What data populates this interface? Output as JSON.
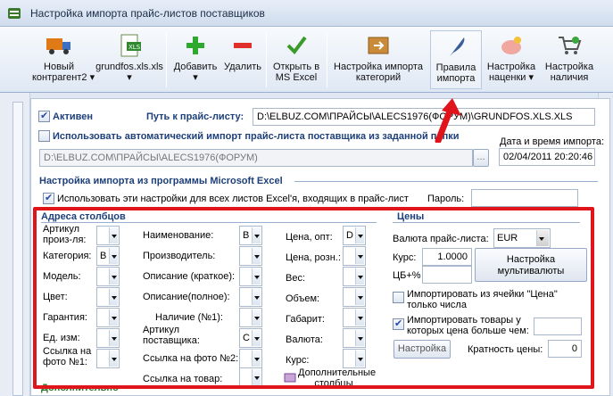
{
  "window": {
    "title": "Настройка импорта прайс-листов поставщиков"
  },
  "toolbar": {
    "items": [
      {
        "label1": "Новый",
        "label2": "контрагент2",
        "dropdown": true,
        "icon": "truck-icon"
      },
      {
        "label1": "grundfos.xls.xls",
        "label2": "",
        "dropdown": true,
        "icon": "xls-file-icon"
      },
      {
        "label1": "Добавить",
        "label2": "",
        "dropdown": true,
        "icon": "plus-icon"
      },
      {
        "label1": "Удалить",
        "label2": "",
        "dropdown": false,
        "icon": "minus-icon"
      },
      {
        "label1": "Открыть в",
        "label2": "MS Excel",
        "dropdown": false,
        "icon": "checkmark-icon"
      },
      {
        "label1": "Настройка импорта",
        "label2": "категорий",
        "dropdown": false,
        "icon": "import-box-icon"
      },
      {
        "label1": "Правила",
        "label2": "импорта",
        "dropdown": false,
        "icon": "feather-pen-icon"
      },
      {
        "label1": "Настройка",
        "label2": "наценки",
        "dropdown": true,
        "icon": "piggy-bank-icon"
      },
      {
        "label1": "Настройка",
        "label2": "наличия",
        "dropdown": false,
        "icon": "shopping-cart-icon"
      }
    ]
  },
  "form": {
    "active_label": "Активен",
    "active_checked": true,
    "path_label": "Путь к прайс-листу:",
    "path_value": "D:\\ELBUZ.COM\\ПРАЙСЫ\\ALECS1976(ФОРУМ)\\GRUNDFOS.XLS.XLS",
    "auto_import_label": "Использовать автоматический импорт прайс-листа поставщика из заданной папки",
    "auto_path_value": "D:\\ELBUZ.COM\\ПРАЙСЫ\\ALECS1976(ФОРУМ)",
    "browse_label": "...",
    "datetime_label": "Дата и время импорта:",
    "datetime_value": "02/04/2011 20:20:46",
    "excel_header": "Настройка импорта из программы Microsoft Excel",
    "use_all_sheets_label": "Использовать эти настройки для всех листов Excel'я, входящих в прайс-лист",
    "password_label": "Пароль:",
    "columns_header": "Адреса столбцов",
    "prices_header": "Цены",
    "col1": [
      {
        "l1": "Артикул",
        "l2": "произ-ля:",
        "v": ""
      },
      {
        "l1": "Категория:",
        "l2": "",
        "v": "B"
      },
      {
        "l1": "Модель:",
        "l2": "",
        "v": ""
      },
      {
        "l1": "Цвет:",
        "l2": "",
        "v": ""
      },
      {
        "l1": "Гарантия:",
        "l2": "",
        "v": ""
      },
      {
        "l1": "Ед. изм:",
        "l2": "",
        "v": ""
      },
      {
        "l1": "Ссылка на",
        "l2": "фото №1:",
        "v": ""
      }
    ],
    "col2": [
      {
        "l1": "Наименование:",
        "l2": "",
        "v": "B"
      },
      {
        "l1": "Производитель:",
        "l2": "",
        "v": ""
      },
      {
        "l1": "Описание (краткое):",
        "l2": "",
        "v": ""
      },
      {
        "l1": "Описание(полное):",
        "l2": "",
        "v": ""
      },
      {
        "l1": "Наличие (№1):",
        "l2": "",
        "v": ""
      },
      {
        "l1": "Артикул",
        "l2": "поставщика:",
        "v": "C"
      },
      {
        "l1": "Ссылка на фото №2:",
        "l2": "",
        "v": ""
      },
      {
        "l1": "Ссылка на товар:",
        "l2": "",
        "v": ""
      }
    ],
    "col3": [
      {
        "l1": "Цена, опт:",
        "l2": "",
        "v": "D"
      },
      {
        "l1": "Цена, розн.:",
        "l2": "",
        "v": ""
      },
      {
        "l1": "Вес:",
        "l2": "",
        "v": ""
      },
      {
        "l1": "Объем:",
        "l2": "",
        "v": ""
      },
      {
        "l1": "Габарит:",
        "l2": "",
        "v": ""
      },
      {
        "l1": "Валюта:",
        "l2": "",
        "v": ""
      },
      {
        "l1": "Курс:",
        "l2": "",
        "v": ""
      }
    ],
    "additional_columns_label": "Дополнительные столбцы",
    "currency_label": "Валюта прайс-листа:",
    "currency_value": "EUR",
    "rate_label": "Курс:",
    "rate_value": "1.0000",
    "cb_label": "ЦБ+%",
    "multicurrency_button": "Настройка мультивалюты",
    "import_from_price_cell_label": "Импортировать из ячейки \"Цена\" только числа",
    "import_from_price_cell_checked": false,
    "import_greater_label": "Импортировать товары у которых цена больше чем:",
    "import_greater_checked": true,
    "settings_button": "Настройка",
    "multiplicity_label": "Кратность цены:",
    "multiplicity_value": "0",
    "bottom_header_partial": "Дополнительно"
  }
}
